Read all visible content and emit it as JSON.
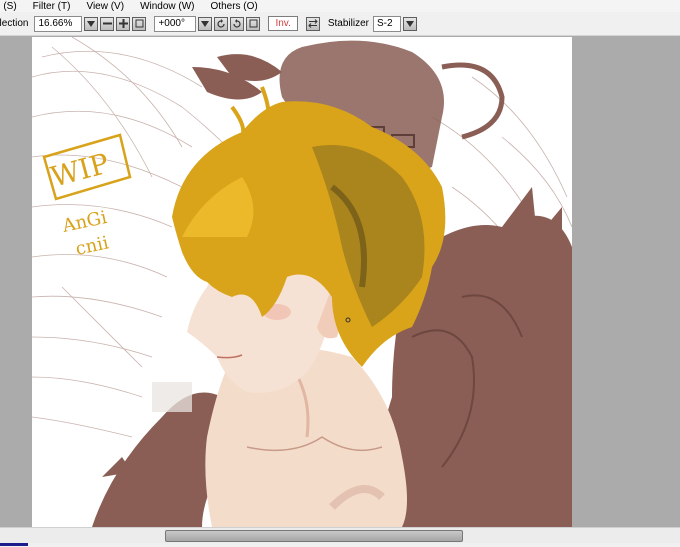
{
  "menu": {
    "items": [
      "n (S)",
      "Filter (T)",
      "View (V)",
      "Window (W)",
      "Others (O)"
    ]
  },
  "toolbar": {
    "selection_label": "election",
    "zoom_value": "16.66%",
    "rotation_value": "+000°",
    "invert_label": "Inv.",
    "stabilizer_label": "Stabilizer",
    "stabilizer_value": "S-2"
  },
  "canvas": {
    "wip_text": "WIP",
    "sig_line1": "AnGi",
    "sig_line2": "cnii",
    "colors": {
      "feather_brown": "#8a5e55",
      "hair_gold": "#d9a419",
      "hair_dark": "#6a5418",
      "skin": "#f4dccb",
      "wing_line": "#b89a94",
      "signature": "#d8a21a"
    }
  }
}
